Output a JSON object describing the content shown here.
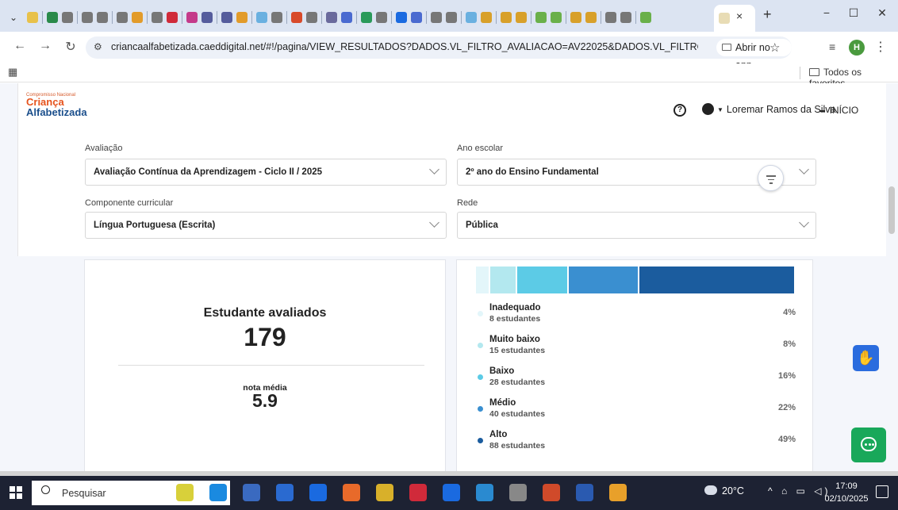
{
  "browser": {
    "active_tab_close": "×",
    "new_tab": "+",
    "window_controls": {
      "minimize": "−",
      "maximize": "☐",
      "close": "✕"
    },
    "address": "criancaalfabetizada.caeddigital.net/#!/pagina/VIEW_RESULTADOS?DADOS.VL_FILTRO_AVALIACAO=AV22025&DADOS.VL_FILTRO_ETAPA=ENSINO...",
    "open_in_app": "Abrir no app",
    "profile_initial": "H",
    "all_bookmarks": "Todos os favoritos"
  },
  "header": {
    "logo_small": "Compromisso Nacional",
    "logo_line1": "Criança",
    "logo_line2": "Alfabetizada",
    "user_name": "Loremar Ramos da Silva",
    "home_label": "INÍCIO"
  },
  "filters": {
    "avaliacao": {
      "label": "Avaliação",
      "value": "Avaliação Contínua da Aprendizagem - Ciclo II / 2025"
    },
    "ano_escolar": {
      "label": "Ano escolar",
      "value": "2º ano do Ensino Fundamental"
    },
    "componente": {
      "label": "Componente curricular",
      "value": "Língua Portuguesa (Escrita)"
    },
    "rede": {
      "label": "Rede",
      "value": "Pública"
    }
  },
  "summary": {
    "evaluated_label": "Estudante avaliados",
    "evaluated_count": "179",
    "average_label": "nota média",
    "average_value": "5.9"
  },
  "distribution": {
    "levels": [
      {
        "name": "Inadequado",
        "count": "8 estudantes",
        "percent": "4%",
        "share": 4,
        "color": "#e3f6fa"
      },
      {
        "name": "Muito baixo",
        "count": "15 estudantes",
        "percent": "8%",
        "share": 8,
        "color": "#b3e8ef"
      },
      {
        "name": "Baixo",
        "count": "28 estudantes",
        "percent": "16%",
        "share": 16,
        "color": "#5ccbe6"
      },
      {
        "name": "Médio",
        "count": "40 estudantes",
        "percent": "22%",
        "share": 22,
        "color": "#3a8fd0"
      },
      {
        "name": "Alto",
        "count": "88 estudantes",
        "percent": "49%",
        "share": 49,
        "color": "#1b5c9e"
      }
    ]
  },
  "taskbar": {
    "search_placeholder": "Pesquisar",
    "weather": "20°C",
    "time": "17:09",
    "date": "02/10/2025"
  },
  "colors": {
    "accent_blue": "#2a6cde",
    "chat_green": "#19a85a",
    "logo_orange": "#e6531d",
    "logo_blue": "#1b4f8c"
  },
  "icons": {
    "help": "question-circle-icon",
    "user": "user-circle-icon",
    "home": "grid-icon",
    "filter": "filter-icon",
    "accessibility": "sign-language-icon",
    "chat": "chat-bubble-icon"
  }
}
